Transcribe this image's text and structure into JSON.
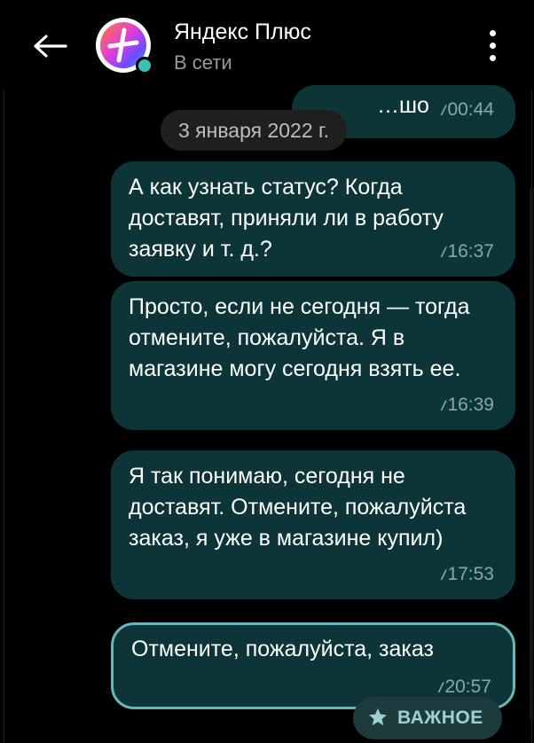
{
  "header": {
    "title": "Яндекс Плюс",
    "status": "В сети"
  },
  "date_separator": "3 января 2022 г.",
  "messages": [
    {
      "text": "…шо",
      "time": "00:44"
    },
    {
      "text": "А как узнать статус? Когда доставят, приняли ли в работу заявку и т. д.?",
      "time": "16:37"
    },
    {
      "text": "Просто, если не сегодня — тогда отмените, пожалуйста. Я в магазине могу сегодня взять ее.",
      "time": "16:39"
    },
    {
      "text": "Я так понимаю, сегодня не доставят. Отмените, пожалуйста заказ, я уже в магазине купил)",
      "time": "17:53"
    },
    {
      "text": "Отмените, пожалуйста, заказ",
      "time": "20:57"
    }
  ],
  "important_button": {
    "label": "ВАЖНОЕ",
    "icon": "star-icon"
  },
  "icons": {
    "back": "arrow-left-icon",
    "menu": "more-vertical-icon"
  },
  "colors": {
    "bubble": "#0d3537",
    "accent": "#3ec1b5",
    "selected_border": "#6ab7b7"
  }
}
